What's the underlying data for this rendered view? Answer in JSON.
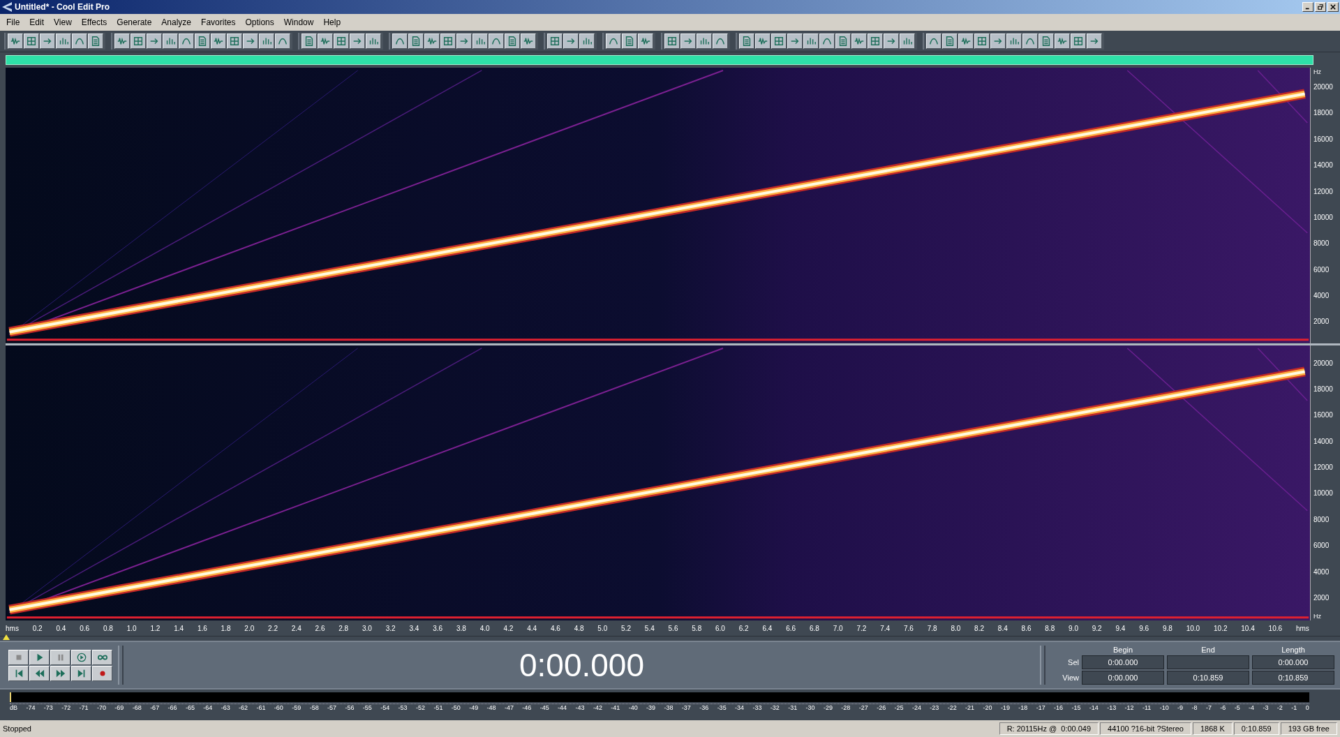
{
  "window": {
    "title": "Untitled* - Cool Edit Pro"
  },
  "menu": [
    "File",
    "Edit",
    "View",
    "Effects",
    "Generate",
    "Analyze",
    "Favorites",
    "Options",
    "Window",
    "Help"
  ],
  "frequency_axis": {
    "top": {
      "unit": "Hz",
      "labels": [
        "20000",
        "18000",
        "16000",
        "14000",
        "12000",
        "10000",
        "8000",
        "6000",
        "4000",
        "2000"
      ]
    },
    "bottom": {
      "unit": "Hz",
      "labels": [
        "20000",
        "18000",
        "16000",
        "14000",
        "12000",
        "10000",
        "8000",
        "6000",
        "4000",
        "2000"
      ]
    }
  },
  "time_ruler": {
    "unit": "hms",
    "labels": [
      "0.2",
      "0.4",
      "0.6",
      "0.8",
      "1.0",
      "1.2",
      "1.4",
      "1.6",
      "1.8",
      "2.0",
      "2.2",
      "2.4",
      "2.6",
      "2.8",
      "3.0",
      "3.2",
      "3.4",
      "3.6",
      "3.8",
      "4.0",
      "4.2",
      "4.4",
      "4.6",
      "4.8",
      "5.0",
      "5.2",
      "5.4",
      "5.6",
      "5.8",
      "6.0",
      "6.2",
      "6.4",
      "6.6",
      "6.8",
      "7.0",
      "7.2",
      "7.4",
      "7.6",
      "7.8",
      "8.0",
      "8.2",
      "8.4",
      "8.6",
      "8.8",
      "9.0",
      "9.2",
      "9.4",
      "9.6",
      "9.8",
      "10.0",
      "10.2",
      "10.4",
      "10.6"
    ],
    "end_unit": "hms"
  },
  "time_display": "0:00.000",
  "selection": {
    "columns": [
      "Begin",
      "End",
      "Length"
    ],
    "rows": [
      {
        "label": "Sel",
        "begin": "0:00.000",
        "length": "0:00.000"
      },
      {
        "label": "View",
        "begin": "0:00.000",
        "end": "0:10.859",
        "length": "0:10.859"
      }
    ]
  },
  "level_meter": {
    "labels": [
      "dB",
      "-74",
      "-73",
      "-72",
      "-71",
      "-70",
      "-69",
      "-68",
      "-67",
      "-66",
      "-65",
      "-64",
      "-63",
      "-62",
      "-61",
      "-60",
      "-59",
      "-58",
      "-57",
      "-56",
      "-55",
      "-54",
      "-53",
      "-52",
      "-51",
      "-50",
      "-49",
      "-48",
      "-47",
      "-46",
      "-45",
      "-44",
      "-43",
      "-42",
      "-41",
      "-40",
      "-39",
      "-38",
      "-37",
      "-36",
      "-35",
      "-34",
      "-33",
      "-32",
      "-31",
      "-30",
      "-29",
      "-28",
      "-27",
      "-26",
      "-25",
      "-24",
      "-23",
      "-22",
      "-21",
      "-20",
      "-19",
      "-18",
      "-17",
      "-16",
      "-15",
      "-14",
      "-13",
      "-12",
      "-11",
      "-10",
      "-9",
      "-8",
      "-7",
      "-6",
      "-5",
      "-4",
      "-3",
      "-2",
      "-1",
      "0"
    ]
  },
  "status_bar": {
    "state": "Stopped",
    "fields": [
      "R: 20115Hz @  0:00.049",
      "44100 ?16-bit ?Stereo",
      "1868 K",
      "0:10.859",
      "193 GB free"
    ]
  }
}
